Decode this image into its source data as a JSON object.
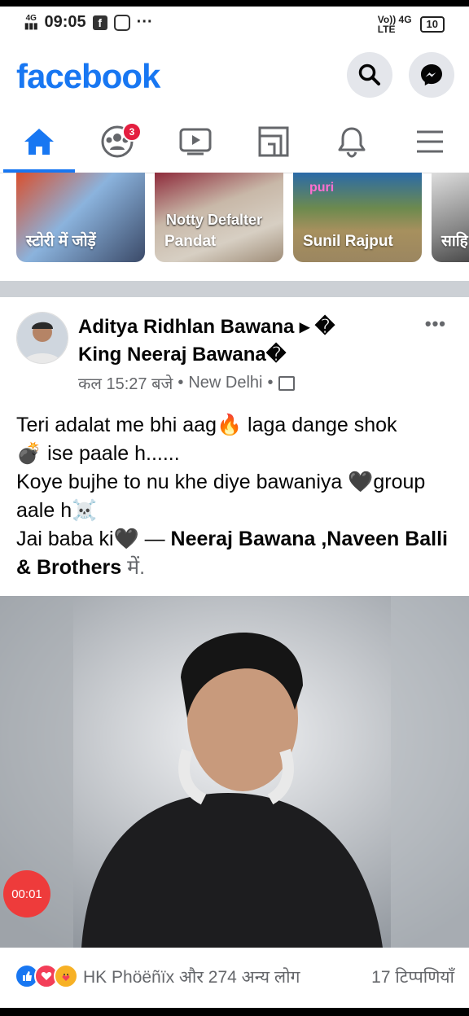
{
  "status_bar": {
    "network_top": "4G",
    "time": "09:05",
    "dots": "···",
    "volte": "Vo)) 4G",
    "lte": "LTE",
    "battery": "10"
  },
  "header": {
    "logo": "facebook",
    "search_icon": "search-icon",
    "messenger_icon": "messenger-icon"
  },
  "tabs": {
    "friends_badge": "3",
    "items": [
      "home-icon",
      "friends-icon",
      "watch-icon",
      "marketplace-icon",
      "notifications-icon",
      "menu-icon"
    ]
  },
  "stories": [
    {
      "label": "स्टोरी में जोड़ें"
    },
    {
      "label": "Pandat",
      "overlay": "Notty Defalter"
    },
    {
      "label": "Sunil Rajput",
      "overlay": "puri"
    },
    {
      "label": "साहि"
    }
  ],
  "post": {
    "author_line1": "Aditya Ridhlan Bawana ▸ �",
    "author_line2": "King Neeraj Bawana�",
    "meta_time": "कल 15:27 बजे",
    "meta_location": "New Delhi",
    "more": "•••",
    "text_line1": "Teri adalat me bhi aag🔥 laga dange shok",
    "text_line2": "💣 ise paale h......",
    "text_line3": "Koye bujhe to nu khe diye bawaniya 🖤group",
    "text_line4": "aale h☠️",
    "text_line5_prefix": "Jai baba ki🖤 — ",
    "text_tagged": "Neeraj Bawana ,Naveen Balli & Brothers",
    "text_suffix": " में.",
    "video_timer": "00:01"
  },
  "reactions": {
    "text": "HK Phöëñïx और 274 अन्य लोग",
    "comments": "17 टिप्पणियाँ",
    "colors": {
      "like": "#1877f2",
      "love": "#f33e58",
      "care": "#f7b125"
    }
  }
}
